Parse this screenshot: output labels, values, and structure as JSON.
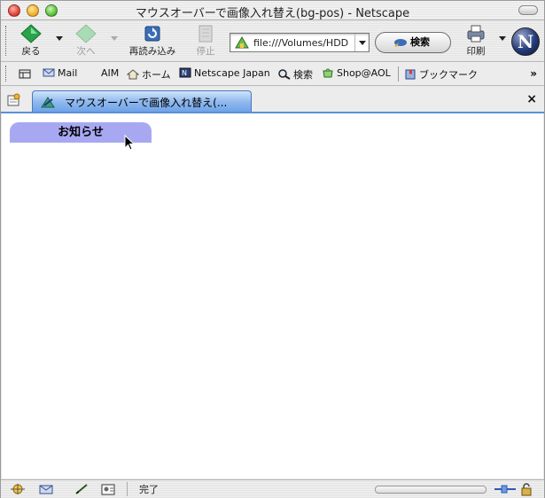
{
  "window": {
    "title": "マウスオーバーで画像入れ替え(bg-pos) - Netscape"
  },
  "toolbar": {
    "back_label": "戻る",
    "forward_label": "次へ",
    "reload_label": "再読み込み",
    "stop_label": "停止",
    "url_value": "file:///Volumes/HDD",
    "search_label": "検索",
    "print_label": "印刷",
    "logo_letter": "N"
  },
  "personal_toolbar": {
    "items": [
      {
        "label": "Mail",
        "icon": "mail-icon"
      },
      {
        "label": "AIM",
        "icon": "aim-icon"
      },
      {
        "label": "ホーム",
        "icon": "home-icon"
      },
      {
        "label": "Netscape Japan",
        "icon": "netscape-icon"
      },
      {
        "label": "検索",
        "icon": "search-icon"
      },
      {
        "label": "Shop@AOL",
        "icon": "shop-icon"
      },
      {
        "label": "ブックマーク",
        "icon": "bookmark-icon"
      }
    ],
    "overflow": "»"
  },
  "tabs": {
    "active_label": "マウスオーバーで画像入れ替え(...",
    "close_symbol": "×"
  },
  "content": {
    "notice_label": "お知らせ",
    "notice_bg": "#a8a8f2"
  },
  "status": {
    "text": "完了"
  }
}
